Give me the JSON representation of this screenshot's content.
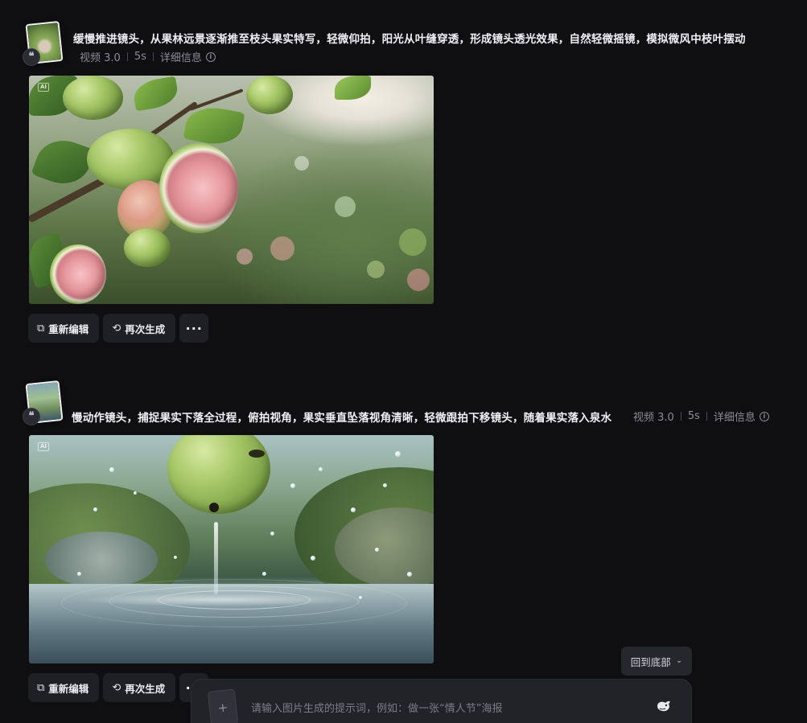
{
  "items": [
    {
      "prompt": "缓慢推进镜头，从果林远景逐渐推至枝头果实特写，轻微仰拍，阳光从叶缝穿透，形成镜头透光效果，自然轻微摇镜，模拟微风中枝叶摆动",
      "model": "视频 3.0",
      "duration": "5s",
      "details_label": "详细信息",
      "ai_tag": "AI"
    },
    {
      "prompt": "慢动作镜头，捕捉果实下落全过程，俯拍视角，果实垂直坠落视角清晰，轻微跟拍下移镜头，随着果实落入泉水",
      "model": "视频 3.0",
      "duration": "5s",
      "details_label": "详细信息",
      "ai_tag": "AI"
    }
  ],
  "actions": {
    "reedit_label": "重新编辑",
    "regenerate_label": "再次生成",
    "more_label": "···"
  },
  "scroll_bottom_label": "回到底部",
  "prompt_bar": {
    "placeholder": "请输入图片生成的提示词，例如：做一张“情人节”海报",
    "add_label": "+"
  },
  "icons": {
    "quote": "quote-icon",
    "info": "info-icon",
    "edit": "edit-icon",
    "regenerate": "regenerate-icon",
    "more": "more-icon",
    "chevron": "double-chevron-down-icon",
    "send": "whale-send-icon"
  }
}
